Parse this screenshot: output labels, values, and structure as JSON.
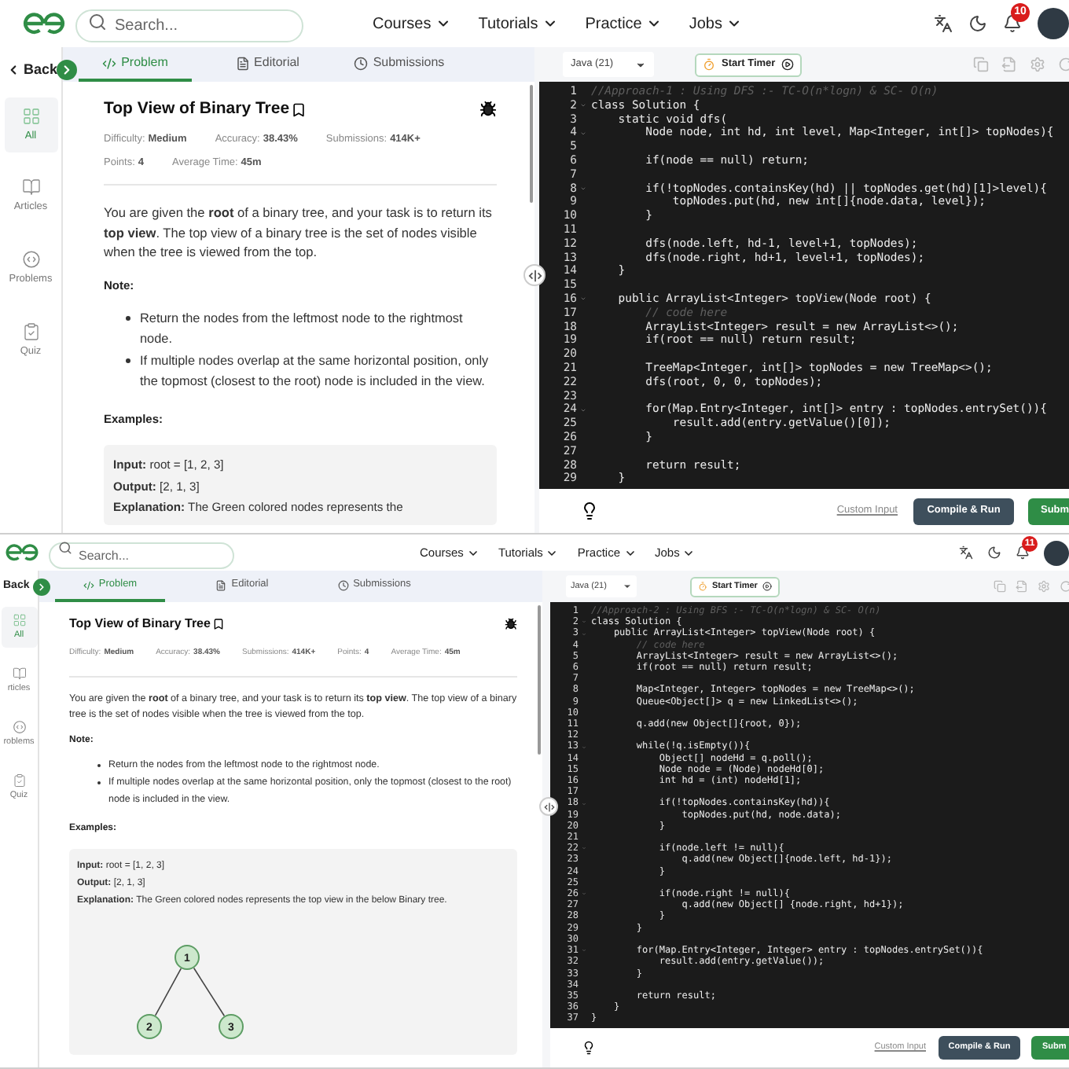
{
  "screens": [
    {
      "header": {
        "search_placeholder": "Search...",
        "nav": [
          {
            "label": "Courses"
          },
          {
            "label": "Tutorials"
          },
          {
            "label": "Practice"
          },
          {
            "label": "Jobs"
          }
        ],
        "notification_count": "10"
      },
      "sidebar": {
        "back": "Back",
        "items": [
          {
            "label": "All",
            "selected": true
          },
          {
            "label": "Articles",
            "selected": false
          },
          {
            "label": "Problems",
            "selected": false
          },
          {
            "label": "Quiz",
            "selected": false
          }
        ]
      },
      "problem": {
        "tabs": [
          {
            "label": "Problem",
            "selected": true
          },
          {
            "label": "Editorial",
            "selected": false
          },
          {
            "label": "Submissions",
            "selected": false
          }
        ],
        "title": "Top View of Binary Tree",
        "meta_rows": [
          [
            {
              "label": "Difficulty:",
              "value": "Medium"
            },
            {
              "label": "Accuracy:",
              "value": "38.43%"
            },
            {
              "label": "Submissions:",
              "value": "414K+"
            }
          ],
          [
            {
              "label": "Points:",
              "value": "4"
            },
            {
              "label": "Average Time:",
              "value": "45m"
            }
          ]
        ],
        "intro": "You are given the **root** of a binary tree, and your task is to return its **top view**. The top view of a binary tree is the set of nodes visible when the tree is viewed from the top.",
        "note_heading": "Note:",
        "notes": [
          "Return the nodes from the leftmost node to the rightmost node.",
          "If multiple nodes overlap at the same horizontal position, only the topmost (closest to the root) node is included in the view."
        ],
        "examples_heading": "Examples:",
        "example_lines": [
          "**Input:** root = [1, 2, 3]",
          "**Output:** [2, 1, 3]",
          "**Explanation:** The Green colored nodes represents the"
        ]
      },
      "editor": {
        "language": "Java (21)",
        "timer": "Start Timer",
        "custom_input": "Custom Input",
        "compile": "Compile & Run",
        "submit": "Subm",
        "code": [
          {
            "n": "1",
            "text": "//Approach-1 : Using DFS :- TC-O(n*logn) & SC- O(n)",
            "kind": "comment"
          },
          {
            "n": "2",
            "text": "class Solution {",
            "fold": true
          },
          {
            "n": "3",
            "text": "    static void dfs("
          },
          {
            "n": "4",
            "text": "        Node node, int hd, int level, Map<Integer, int[]> topNodes){",
            "fold": true
          },
          {
            "n": "5"
          },
          {
            "n": "6",
            "text": "        if(node == null) return;"
          },
          {
            "n": "7"
          },
          {
            "n": "8",
            "text": "        if(!topNodes.containsKey(hd) || topNodes.get(hd)[1]>level){",
            "fold": true
          },
          {
            "n": "9",
            "text": "            topNodes.put(hd, new int[]{node.data, level});"
          },
          {
            "n": "10",
            "text": "        }"
          },
          {
            "n": "11"
          },
          {
            "n": "12",
            "text": "        dfs(node.left, hd-1, level+1, topNodes);"
          },
          {
            "n": "13",
            "text": "        dfs(node.right, hd+1, level+1, topNodes);"
          },
          {
            "n": "14",
            "text": "    }"
          },
          {
            "n": "15"
          },
          {
            "n": "16",
            "text": "    public ArrayList<Integer> topView(Node root) {",
            "fold": true
          },
          {
            "n": "17",
            "text": "        // code here",
            "kind": "comment"
          },
          {
            "n": "18",
            "text": "        ArrayList<Integer> result = new ArrayList<>();"
          },
          {
            "n": "19",
            "text": "        if(root == null) return result;"
          },
          {
            "n": "20"
          },
          {
            "n": "21",
            "text": "        TreeMap<Integer, int[]> topNodes = new TreeMap<>();"
          },
          {
            "n": "22",
            "text": "        dfs(root, 0, 0, topNodes);"
          },
          {
            "n": "23"
          },
          {
            "n": "24",
            "text": "        for(Map.Entry<Integer, int[]> entry : topNodes.entrySet()){",
            "fold": true
          },
          {
            "n": "25",
            "text": "            result.add(entry.getValue()[0]);"
          },
          {
            "n": "26",
            "text": "        }"
          },
          {
            "n": "27"
          },
          {
            "n": "28",
            "text": "        return result;"
          },
          {
            "n": "29",
            "text": "    }"
          }
        ]
      }
    },
    {
      "header": {
        "search_placeholder": "Search...",
        "nav": [
          {
            "label": "Courses"
          },
          {
            "label": "Tutorials"
          },
          {
            "label": "Practice"
          },
          {
            "label": "Jobs"
          }
        ],
        "notification_count": "11"
      },
      "sidebar": {
        "back": "Back",
        "items": [
          {
            "label": "All",
            "selected": true
          },
          {
            "label": "rticles",
            "selected": false
          },
          {
            "label": "roblems",
            "selected": false
          },
          {
            "label": "Quiz",
            "selected": false
          }
        ]
      },
      "problem": {
        "tabs": [
          {
            "label": "Problem",
            "selected": true
          },
          {
            "label": "Editorial",
            "selected": false
          },
          {
            "label": "Submissions",
            "selected": false
          }
        ],
        "title": "Top View of Binary Tree",
        "meta_rows": [
          [
            {
              "label": "Difficulty:",
              "value": "Medium"
            },
            {
              "label": "Accuracy:",
              "value": "38.43%"
            },
            {
              "label": "Submissions:",
              "value": "414K+"
            },
            {
              "label": "Points:",
              "value": "4"
            },
            {
              "label": "Average Time:",
              "value": "45m"
            }
          ]
        ],
        "intro": "You are given the **root** of a binary tree, and your task is to return its **top view**. The top view of a binary tree is the set of nodes visible when the tree is viewed from the top.",
        "note_heading": "Note:",
        "notes": [
          "Return the nodes from the leftmost node to the rightmost node.",
          "If multiple nodes overlap at the same horizontal position, only the topmost (closest to the root) node is included in the view."
        ],
        "examples_heading": "Examples:",
        "example_lines": [
          "**Input:** root = [1, 2, 3]",
          "**Output:** [2, 1, 3]",
          "**Explanation:** The Green colored nodes represents the top view in the below Binary tree."
        ],
        "tree": {
          "nodes": [
            {
              "label": "1"
            },
            {
              "label": "2"
            },
            {
              "label": "3"
            }
          ]
        }
      },
      "editor": {
        "language": "Java (21)",
        "timer": "Start Timer",
        "custom_input": "Custom Input",
        "compile": "Compile & Run",
        "submit": "Subm",
        "code": [
          {
            "n": "1",
            "text": "//Approach-2 : Using BFS :- TC-O(n*logn) & SC- O(n)",
            "kind": "comment"
          },
          {
            "n": "2",
            "text": "class Solution {",
            "fold": true
          },
          {
            "n": "3",
            "text": "    public ArrayList<Integer> topView(Node root) {",
            "fold": true
          },
          {
            "n": "4",
            "text": "        // code here",
            "kind": "comment"
          },
          {
            "n": "5",
            "text": "        ArrayList<Integer> result = new ArrayList<>();"
          },
          {
            "n": "6",
            "text": "        if(root == null) return result;"
          },
          {
            "n": "7"
          },
          {
            "n": "8",
            "text": "        Map<Integer, Integer> topNodes = new TreeMap<>();"
          },
          {
            "n": "9",
            "text": "        Queue<Object[]> q = new LinkedList<>();"
          },
          {
            "n": "10"
          },
          {
            "n": "11",
            "text": "        q.add(new Object[]{root, 0});"
          },
          {
            "n": "12"
          },
          {
            "n": "13",
            "text": "        while(!q.isEmpty()){",
            "fold": true
          },
          {
            "n": "14",
            "text": "            Object[] nodeHd = q.poll();"
          },
          {
            "n": "15",
            "text": "            Node node = (Node) nodeHd[0];"
          },
          {
            "n": "16",
            "text": "            int hd = (int) nodeHd[1];"
          },
          {
            "n": "17"
          },
          {
            "n": "18",
            "text": "            if(!topNodes.containsKey(hd)){",
            "fold": true
          },
          {
            "n": "19",
            "text": "                topNodes.put(hd, node.data);"
          },
          {
            "n": "20",
            "text": "            }"
          },
          {
            "n": "21"
          },
          {
            "n": "22",
            "text": "            if(node.left != null){",
            "fold": true
          },
          {
            "n": "23",
            "text": "                q.add(new Object[]{node.left, hd-1});"
          },
          {
            "n": "24",
            "text": "            }"
          },
          {
            "n": "25"
          },
          {
            "n": "26",
            "text": "            if(node.right != null){",
            "fold": true
          },
          {
            "n": "27",
            "text": "                q.add(new Object[] {node.right, hd+1});"
          },
          {
            "n": "28",
            "text": "            }"
          },
          {
            "n": "29",
            "text": "        }"
          },
          {
            "n": "30"
          },
          {
            "n": "31",
            "text": "        for(Map.Entry<Integer, Integer> entry : topNodes.entrySet()){",
            "fold": true
          },
          {
            "n": "32",
            "text": "            result.add(entry.getValue());"
          },
          {
            "n": "33",
            "text": "        }"
          },
          {
            "n": "34"
          },
          {
            "n": "35",
            "text": "        return result;"
          },
          {
            "n": "36",
            "text": "    }"
          },
          {
            "n": "37",
            "text": "}"
          }
        ]
      }
    }
  ]
}
